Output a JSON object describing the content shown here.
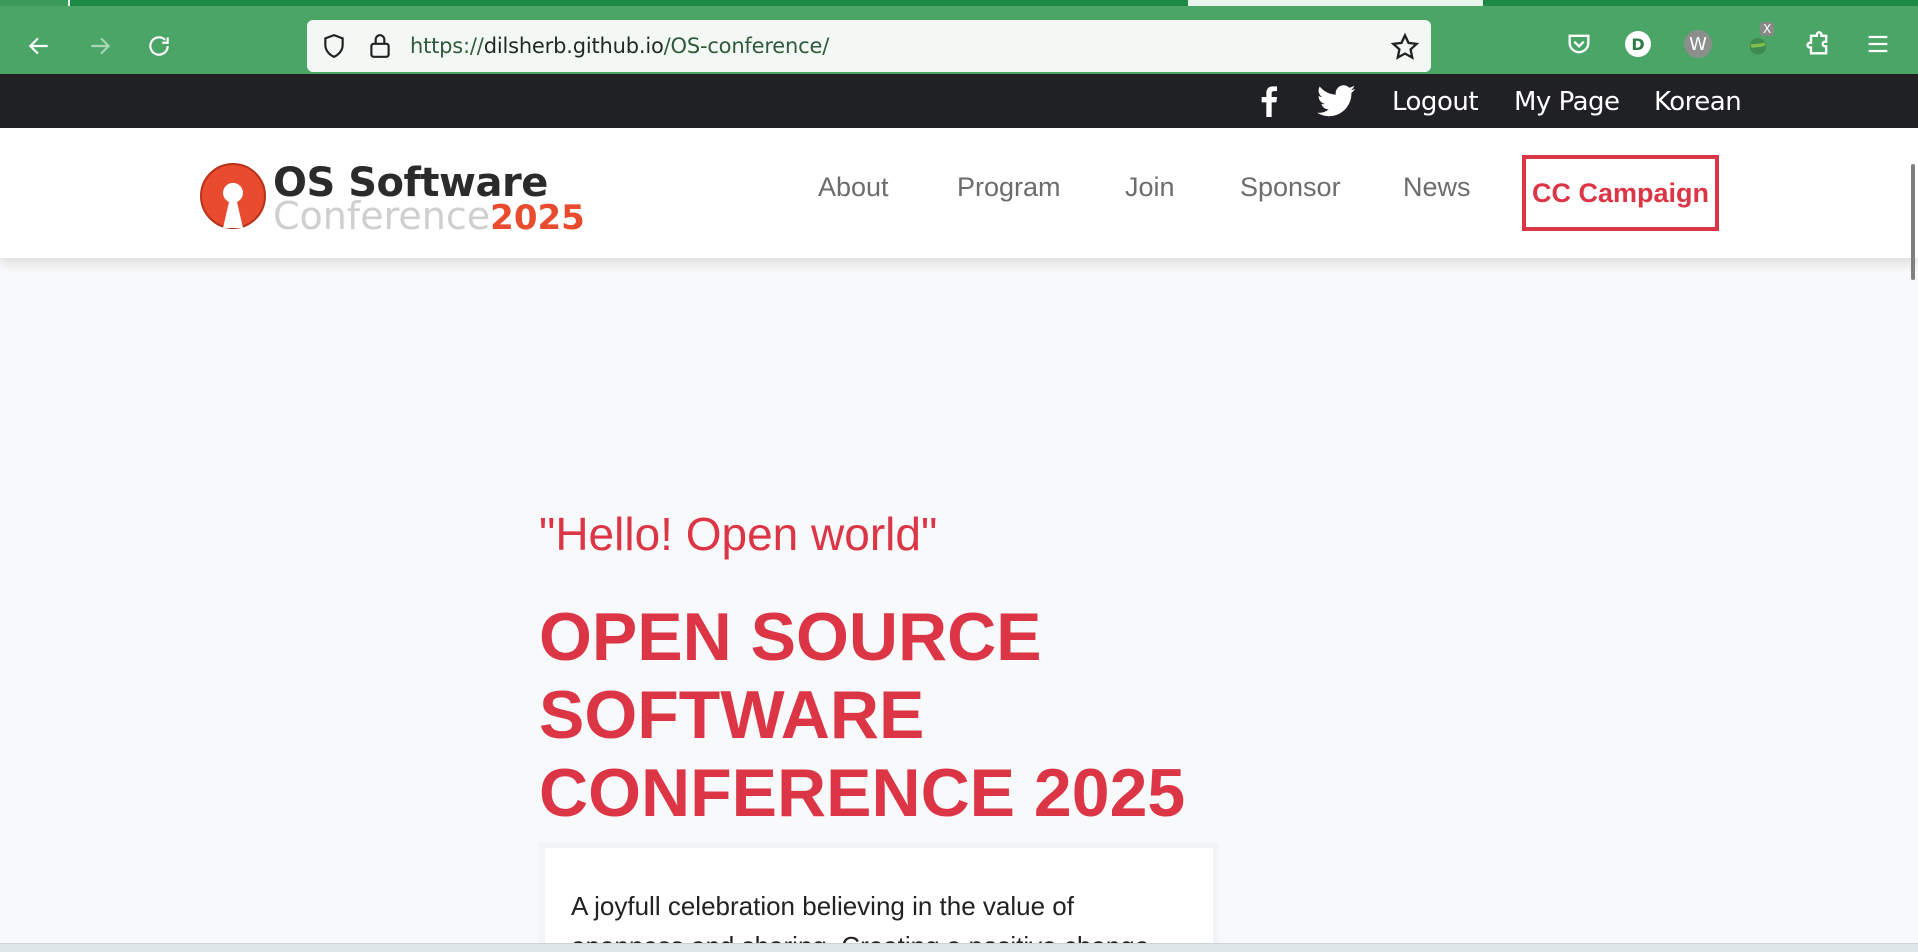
{
  "browser": {
    "url_scheme": "https://",
    "url_host": "dilsherb.github.io",
    "url_path": "/OS-conference/",
    "profile_initial": "D",
    "ext_w": "W",
    "ext_badge": "X"
  },
  "topbar": {
    "links": [
      "Logout",
      "My Page",
      "Korean"
    ]
  },
  "header": {
    "logo_line1": "OS Software",
    "logo_line2": "Conference",
    "logo_year": "2025",
    "menu": [
      "About",
      "Program",
      "Join",
      "Sponsor",
      "News"
    ],
    "cta": "CC Campaign"
  },
  "hero": {
    "tagline": "\"Hello! Open world\"",
    "title": "OPEN SOURCE SOFTWARE CONFERENCE 2025",
    "description": "A joyfull celebration believing in the value of openness and sharing. Creating a positive change"
  },
  "colors": {
    "accent": "#dc3545",
    "browser_green": "#4aa567",
    "topbar": "#1f2124"
  }
}
